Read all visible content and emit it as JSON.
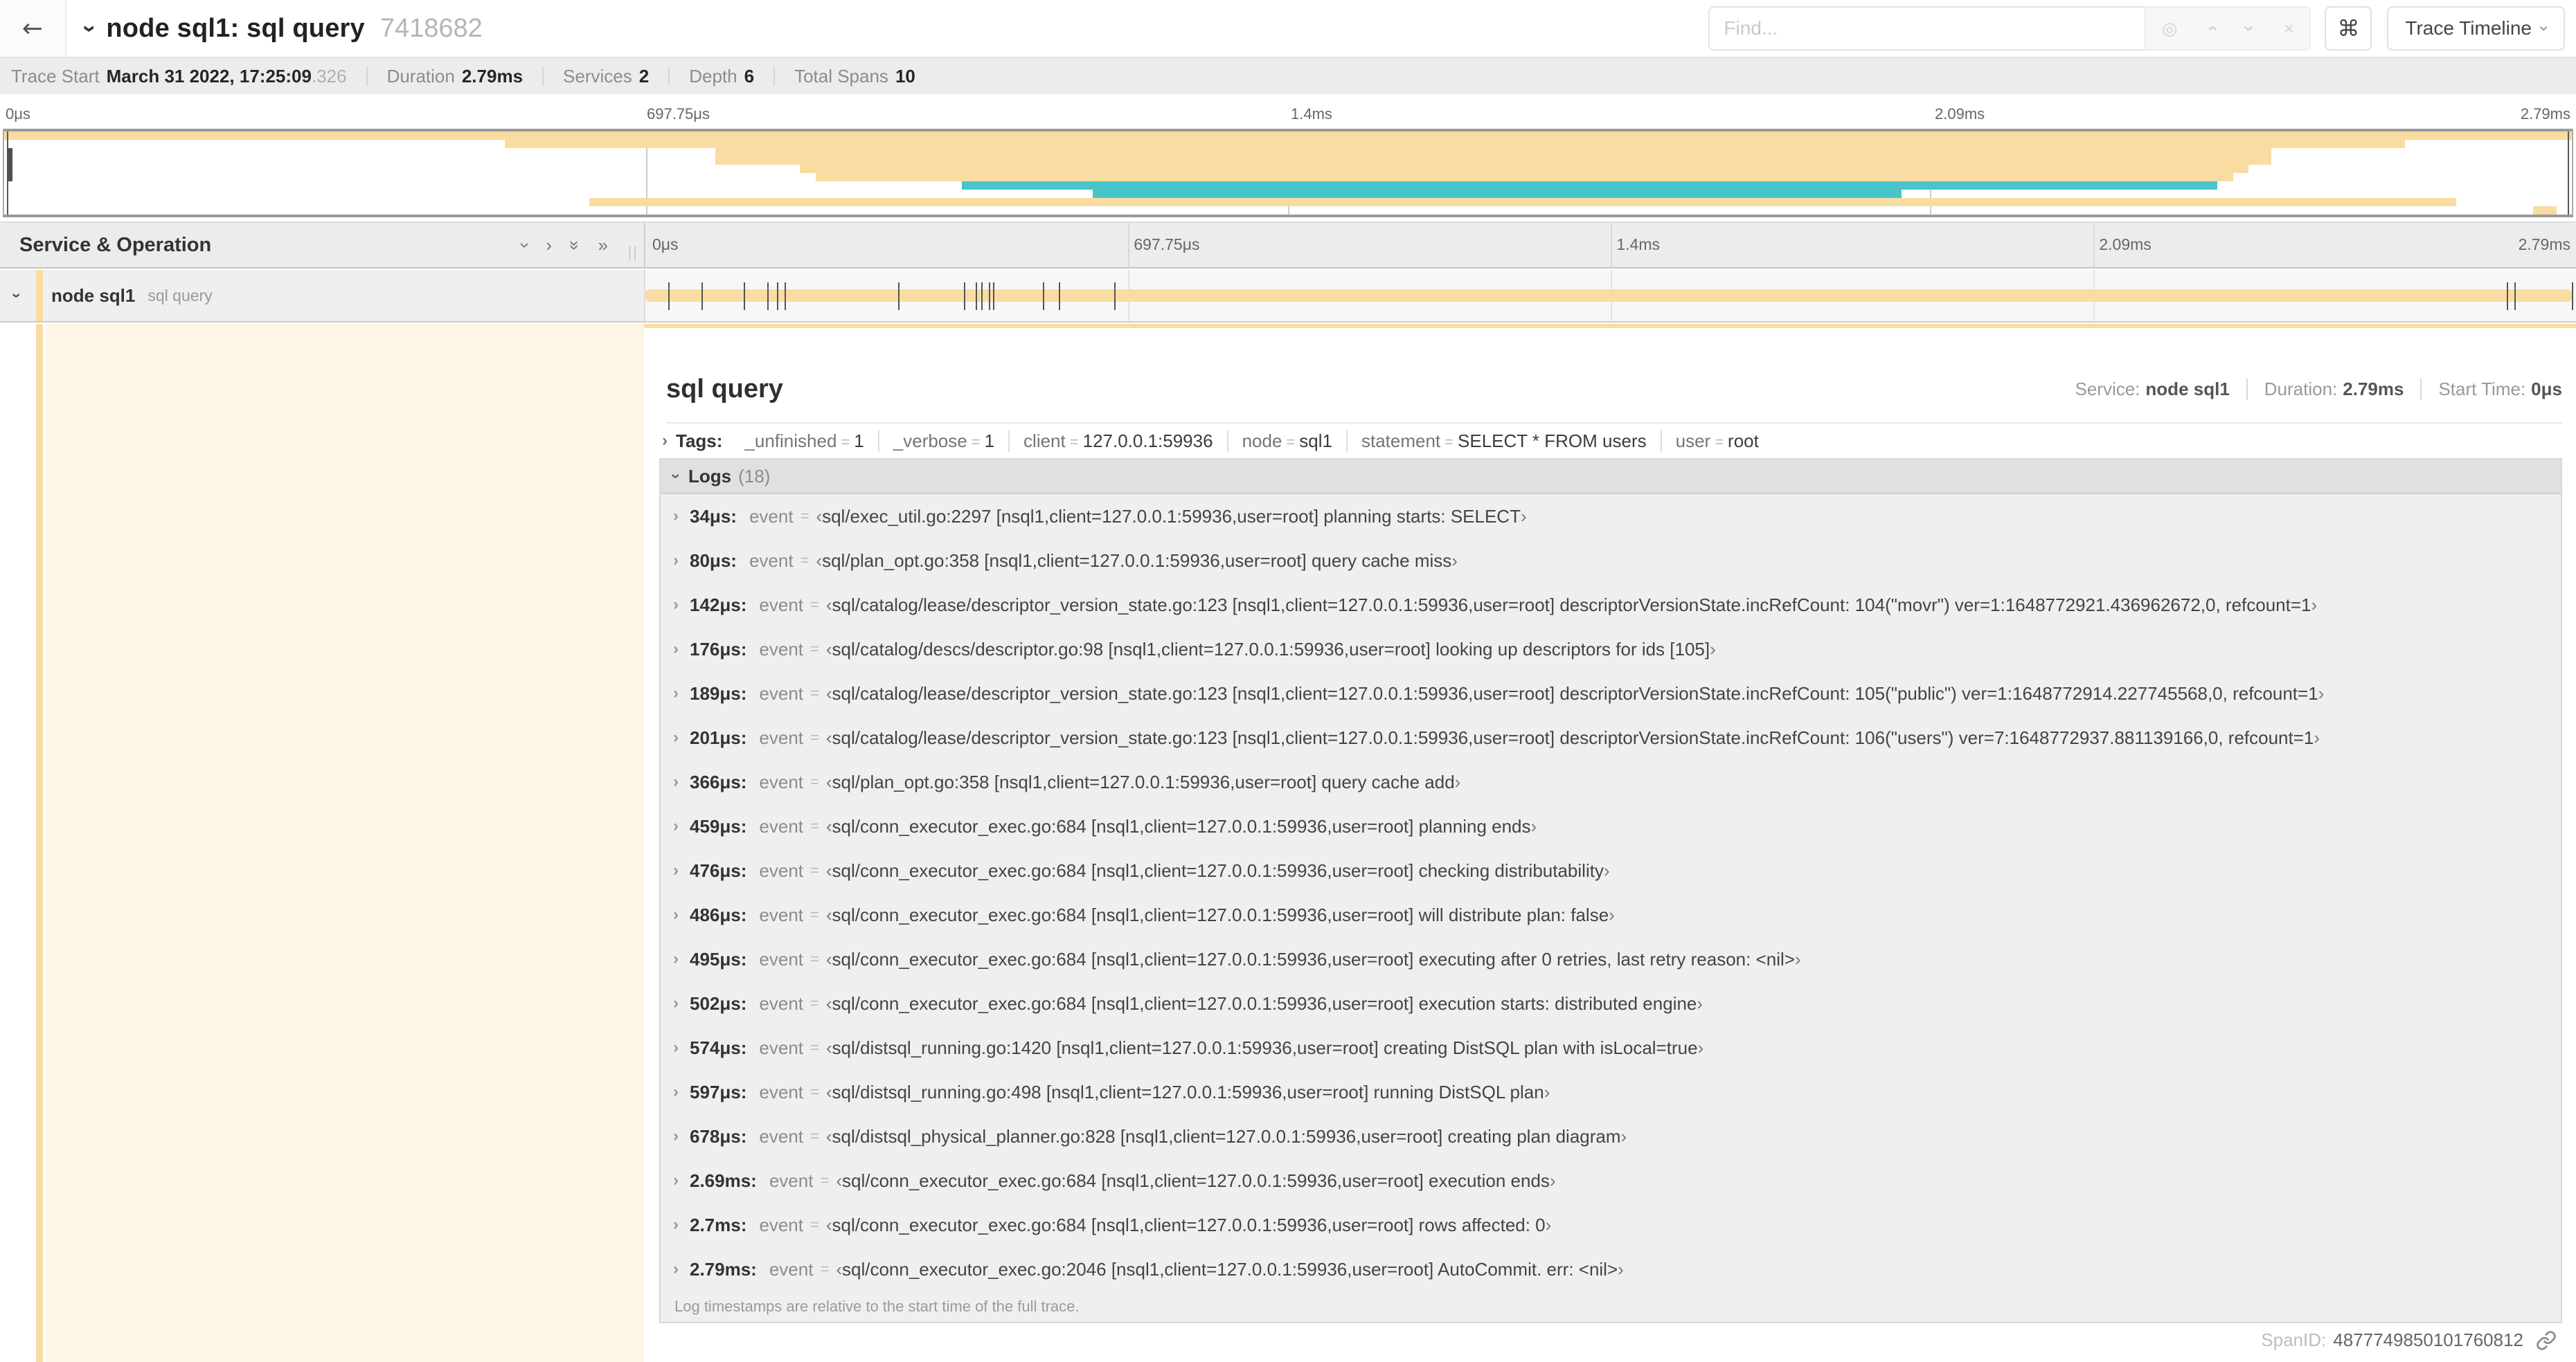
{
  "colors": {
    "tan": "#f8dca1",
    "teal": "#48c5c9",
    "detail_accent": "#f8dca1"
  },
  "icons": {
    "back": "←",
    "chevron": "›",
    "double_chevron": "»",
    "locate": "◎",
    "close": "×",
    "command": "⌘",
    "resizer": "||"
  },
  "header": {
    "title": "node sql1: sql query",
    "trace_id": "7418682",
    "find_placeholder": "Find...",
    "view_selector": "Trace Timeline"
  },
  "summary": {
    "items": [
      {
        "label": "Trace Start",
        "value": "March 31 2022, 17:25:09",
        "suffix": ".326"
      },
      {
        "label": "Duration",
        "value": "2.79ms"
      },
      {
        "label": "Services",
        "value": "2"
      },
      {
        "label": "Depth",
        "value": "6"
      },
      {
        "label": "Total Spans",
        "value": "10"
      }
    ]
  },
  "minimap": {
    "ticks": [
      "0μs",
      "697.75μs",
      "1.4ms",
      "2.09ms",
      "2.79ms"
    ],
    "spans": [
      {
        "start": 0,
        "end": 100,
        "color": "tan"
      },
      {
        "start": 19.5,
        "end": 93.5,
        "color": "tan"
      },
      {
        "start": 27.7,
        "end": 88.3,
        "color": "tan"
      },
      {
        "start": 27.7,
        "end": 88.3,
        "color": "tan"
      },
      {
        "start": 31.0,
        "end": 87.4,
        "color": "tan"
      },
      {
        "start": 31.6,
        "end": 86.8,
        "color": "tan"
      },
      {
        "start": 37.3,
        "end": 86.2,
        "color": "teal"
      },
      {
        "start": 42.4,
        "end": 73.9,
        "color": "teal"
      },
      {
        "start": 22.8,
        "end": 95.5,
        "color": "tan"
      },
      {
        "start": 98.5,
        "end": 99.4,
        "color": "tan"
      }
    ]
  },
  "timeline": {
    "column_header": "Service & Operation",
    "ticks": [
      "0μs",
      "697.75μs",
      "1.4ms",
      "2.09ms",
      "2.79ms"
    ],
    "row": {
      "service": "node sql1",
      "operation": "sql query",
      "bar_color": "tan",
      "log_tick_pcts": [
        1.2,
        2.9,
        5.1,
        6.3,
        6.8,
        7.2,
        13.1,
        16.5,
        17.1,
        17.4,
        17.8,
        18.0,
        20.6,
        21.4,
        24.3,
        96.4,
        96.8,
        99.8
      ]
    }
  },
  "detail": {
    "title": "sql query",
    "meta": {
      "service_label": "Service:",
      "service": "node sql1",
      "duration_label": "Duration:",
      "duration": "2.79ms",
      "start_label": "Start Time:",
      "start": "0μs"
    },
    "tags": {
      "label": "Tags:",
      "items": [
        {
          "key": "_unfinished",
          "value": "1"
        },
        {
          "key": "_verbose",
          "value": "1"
        },
        {
          "key": "client",
          "value": "127.0.0.1:59936"
        },
        {
          "key": "node",
          "value": "sql1"
        },
        {
          "key": "statement",
          "value": "SELECT * FROM users"
        },
        {
          "key": "user",
          "value": "root"
        }
      ]
    },
    "logs": {
      "label": "Logs",
      "count": "(18)",
      "entries": [
        {
          "time": "34μs:",
          "key": "event",
          "value": "sql/exec_util.go:2297 [nsql1,client=127.0.0.1:59936,user=root] planning starts: SELECT"
        },
        {
          "time": "80μs:",
          "key": "event",
          "value": "sql/plan_opt.go:358 [nsql1,client=127.0.0.1:59936,user=root] query cache miss"
        },
        {
          "time": "142μs:",
          "key": "event",
          "value": "sql/catalog/lease/descriptor_version_state.go:123 [nsql1,client=127.0.0.1:59936,user=root] descriptorVersionState.incRefCount: 104(\"movr\") ver=1:1648772921.436962672,0, refcount=1"
        },
        {
          "time": "176μs:",
          "key": "event",
          "value": "sql/catalog/descs/descriptor.go:98 [nsql1,client=127.0.0.1:59936,user=root] looking up descriptors for ids [105]"
        },
        {
          "time": "189μs:",
          "key": "event",
          "value": "sql/catalog/lease/descriptor_version_state.go:123 [nsql1,client=127.0.0.1:59936,user=root] descriptorVersionState.incRefCount: 105(\"public\") ver=1:1648772914.227745568,0, refcount=1"
        },
        {
          "time": "201μs:",
          "key": "event",
          "value": "sql/catalog/lease/descriptor_version_state.go:123 [nsql1,client=127.0.0.1:59936,user=root] descriptorVersionState.incRefCount: 106(\"users\") ver=7:1648772937.881139166,0, refcount=1"
        },
        {
          "time": "366μs:",
          "key": "event",
          "value": "sql/plan_opt.go:358 [nsql1,client=127.0.0.1:59936,user=root] query cache add"
        },
        {
          "time": "459μs:",
          "key": "event",
          "value": "sql/conn_executor_exec.go:684 [nsql1,client=127.0.0.1:59936,user=root] planning ends"
        },
        {
          "time": "476μs:",
          "key": "event",
          "value": "sql/conn_executor_exec.go:684 [nsql1,client=127.0.0.1:59936,user=root] checking distributability"
        },
        {
          "time": "486μs:",
          "key": "event",
          "value": "sql/conn_executor_exec.go:684 [nsql1,client=127.0.0.1:59936,user=root] will distribute plan: false"
        },
        {
          "time": "495μs:",
          "key": "event",
          "value": "sql/conn_executor_exec.go:684 [nsql1,client=127.0.0.1:59936,user=root] executing after 0 retries, last retry reason: <nil>"
        },
        {
          "time": "502μs:",
          "key": "event",
          "value": "sql/conn_executor_exec.go:684 [nsql1,client=127.0.0.1:59936,user=root] execution starts: distributed engine"
        },
        {
          "time": "574μs:",
          "key": "event",
          "value": "sql/distsql_running.go:1420 [nsql1,client=127.0.0.1:59936,user=root] creating DistSQL plan with isLocal=true"
        },
        {
          "time": "597μs:",
          "key": "event",
          "value": "sql/distsql_running.go:498 [nsql1,client=127.0.0.1:59936,user=root] running DistSQL plan"
        },
        {
          "time": "678μs:",
          "key": "event",
          "value": "sql/distsql_physical_planner.go:828 [nsql1,client=127.0.0.1:59936,user=root] creating plan diagram"
        },
        {
          "time": "2.69ms:",
          "key": "event",
          "value": "sql/conn_executor_exec.go:684 [nsql1,client=127.0.0.1:59936,user=root] execution ends"
        },
        {
          "time": "2.7ms:",
          "key": "event",
          "value": "sql/conn_executor_exec.go:684 [nsql1,client=127.0.0.1:59936,user=root] rows affected: 0"
        },
        {
          "time": "2.79ms:",
          "key": "event",
          "value": "sql/conn_executor_exec.go:2046 [nsql1,client=127.0.0.1:59936,user=root] AutoCommit. err: <nil>"
        }
      ],
      "note": "Log timestamps are relative to the start time of the full trace."
    },
    "footer": {
      "label": "SpanID:",
      "value": "4877749850101760812"
    }
  }
}
